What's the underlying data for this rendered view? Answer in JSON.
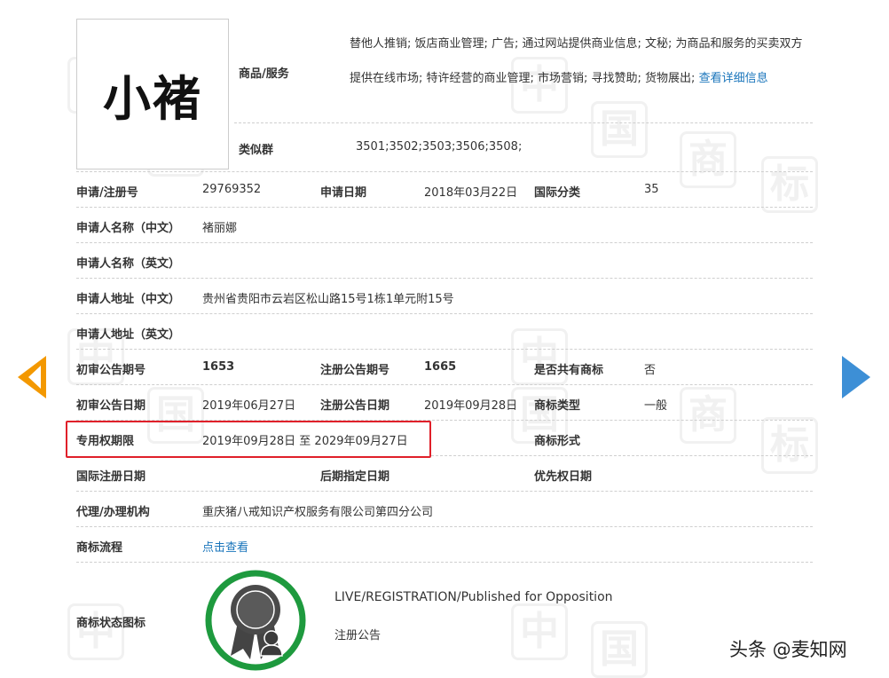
{
  "trademark": {
    "logo_text": "小褚",
    "goods_label": "商品/服务",
    "goods_text": "替他人推销; 饭店商业管理; 广告; 通过网站提供商业信息; 文秘; 为商品和服务的买卖双方提供在线市场; 特许经营的商业管理; 市场营销; 寻找赞助; 货物展出; ",
    "goods_more_link": "查看详细信息",
    "similar_label": "类似群",
    "similar_value": "3501;3502;3503;3506;3508;"
  },
  "fields": {
    "reg_no_label": "申请/注册号",
    "reg_no_value": "29769352",
    "apply_date_label": "申请日期",
    "apply_date_value": "2018年03月22日",
    "intl_class_label": "国际分类",
    "intl_class_value": "35",
    "applicant_cn_label": "申请人名称（中文）",
    "applicant_cn_value": "褚丽娜",
    "applicant_en_label": "申请人名称（英文）",
    "address_cn_label": "申请人地址（中文）",
    "address_cn_value": "贵州省贵阳市云岩区松山路15号1栋1单元附15号",
    "address_en_label": "申请人地址（英文）",
    "prelim_no_label": "初审公告期号",
    "prelim_no_value": "1653",
    "reg_pub_no_label": "注册公告期号",
    "reg_pub_no_value": "1665",
    "shared_label": "是否共有商标",
    "shared_value": "否",
    "prelim_date_label": "初审公告日期",
    "prelim_date_value": "2019年06月27日",
    "reg_pub_date_label": "注册公告日期",
    "reg_pub_date_value": "2019年09月28日",
    "tm_type_label": "商标类型",
    "tm_type_value": "一般",
    "exclusive_label": "专用权期限",
    "exclusive_value": "2019年09月28日 至 2029年09月27日",
    "tm_form_label": "商标形式",
    "intl_reg_date_label": "国际注册日期",
    "later_date_label": "后期指定日期",
    "priority_date_label": "优先权日期",
    "agent_label": "代理/办理机构",
    "agent_value": "重庆猪八戒知识产权服务有限公司第四分公司",
    "flow_label": "商标流程",
    "flow_link": "点击查看",
    "status_icon_label": "商标状态图标",
    "status_en": "LIVE/REGISTRATION/Published for Opposition",
    "status_cn": "注册公告"
  },
  "watermark_char_a": "中",
  "watermark_char_b": "国",
  "watermark_char_c": "商",
  "watermark_char_d": "标",
  "footer": {
    "brand": "头条 @麦知网"
  },
  "colors": {
    "link": "#1a75bb",
    "highlight_border": "#e0202a",
    "nav_prev": "#f39800",
    "nav_next": "#3d8fd6",
    "status_ring": "#1e9a3e"
  },
  "icons": {
    "prev": "prev-arrow-icon",
    "next": "next-arrow-icon",
    "status": "registration-badge-icon"
  }
}
